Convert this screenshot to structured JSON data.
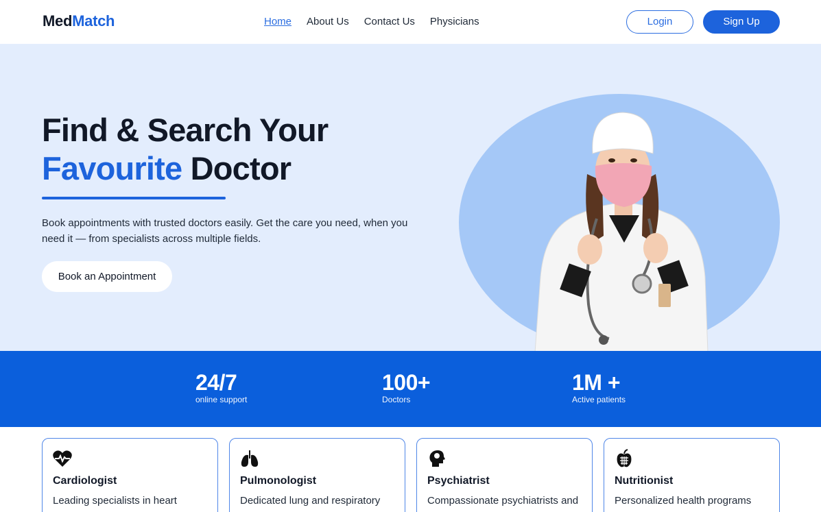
{
  "nav": {
    "brand_part1": "Med",
    "brand_part2": "Match",
    "links": [
      "Home",
      "About Us",
      "Contact Us",
      "Physicians"
    ],
    "login_label": "Login",
    "signup_label": "Sign Up"
  },
  "hero": {
    "title_line1": "Find & Search Your",
    "title_accent": "Favourite",
    "title_rest": " Doctor",
    "description": "Book appointments with trusted doctors easily. Get the care you need, when you need it — from specialists across multiple fields.",
    "cta_label": "Book an Appointment"
  },
  "stats": [
    {
      "value": "24/7",
      "label": "online support"
    },
    {
      "value": "100+",
      "label": "Doctors"
    },
    {
      "value": "1M +",
      "label": "Active patients"
    }
  ],
  "cards": [
    {
      "icon": "heart-pulse-icon",
      "title": "Cardiologist",
      "text": "Leading specialists in heart"
    },
    {
      "icon": "lungs-icon",
      "title": "Pulmonologist",
      "text": "Dedicated lung and respiratory"
    },
    {
      "icon": "brain-head-icon",
      "title": "Psychiatrist",
      "text": "Compassionate psychiatrists and"
    },
    {
      "icon": "apple-icon",
      "title": "Nutritionist",
      "text": "Personalized health programs"
    }
  ],
  "colors": {
    "accent": "#1d63dc",
    "hero_bg": "#e3edfd",
    "stats_bg": "#0b5fdc",
    "circle": "#a5c8f7"
  }
}
